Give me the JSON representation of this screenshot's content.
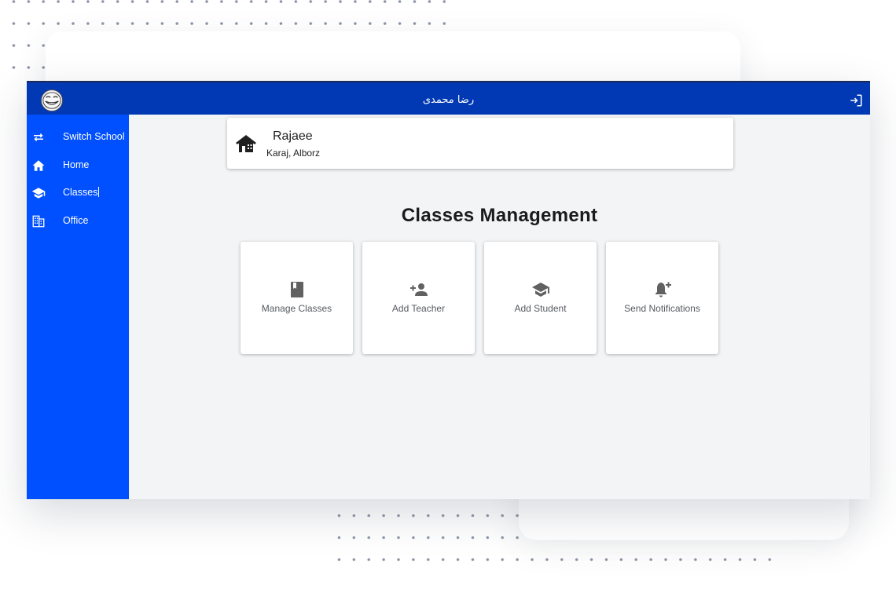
{
  "header": {
    "user_name": "رضا محمدی",
    "avatar_icon": "troll-face-avatar",
    "logout_icon": "logout-icon"
  },
  "sidebar": {
    "items": [
      {
        "label": "Switch School",
        "icon": "swap-arrows-icon"
      },
      {
        "label": "Home",
        "icon": "home-icon"
      },
      {
        "label": "Classes",
        "icon": "graduation-cap-icon"
      },
      {
        "label": "Office",
        "icon": "building-icon"
      }
    ]
  },
  "school": {
    "name": "Rajaee",
    "location": "Karaj, Alborz",
    "icon": "school-house-icon"
  },
  "main": {
    "title": "Classes Management",
    "tiles": [
      {
        "label": "Manage Classes",
        "icon": "book-icon"
      },
      {
        "label": "Add Teacher",
        "icon": "person-add-icon"
      },
      {
        "label": "Add Student",
        "icon": "graduation-cap-icon"
      },
      {
        "label": "Send Notifications",
        "icon": "bell-plus-icon"
      }
    ]
  },
  "colors": {
    "topbar": "#0039b3",
    "sidebar": "#0050ff",
    "content_bg": "#f3f4f6",
    "icon_gray": "#616161"
  }
}
